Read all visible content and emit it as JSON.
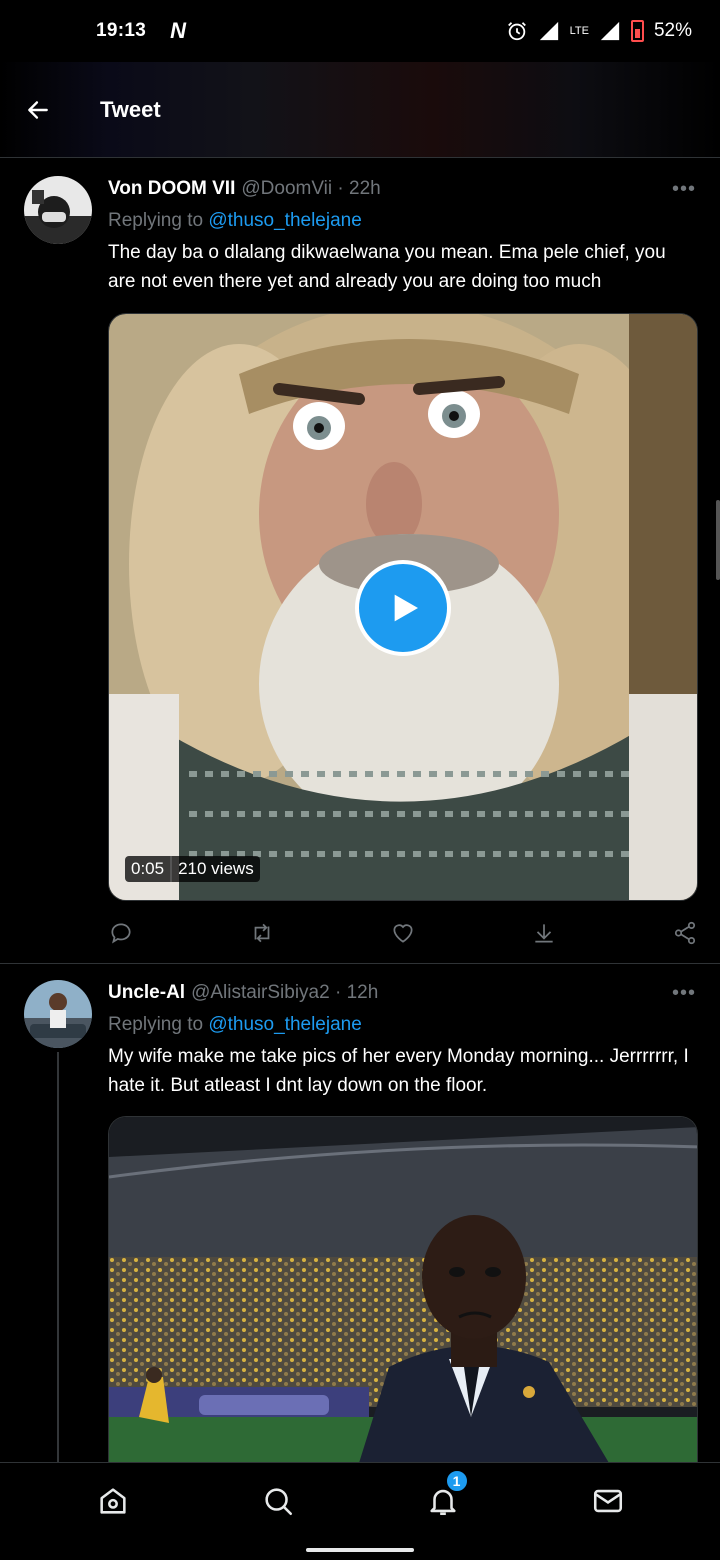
{
  "status": {
    "time": "19:13",
    "carrier_icon": "N",
    "network": "LTE",
    "battery": "52%"
  },
  "header": {
    "title": "Tweet"
  },
  "tweets": [
    {
      "name": "Von DOOM VII",
      "handle": "@DoomVii · 22h",
      "replying_prefix": "Replying to ",
      "replying_to": "@thuso_thelejane",
      "text": "The day ba o dlalang dikwaelwana you mean. Ema pele chief, you are not even there yet and already you are doing too much",
      "video": {
        "duration": "0:05",
        "views": "210 views"
      }
    },
    {
      "name": "Uncle-Al",
      "handle": "@AlistairSibiya2 · 12h",
      "replying_prefix": "Replying to ",
      "replying_to": "@thuso_thelejane",
      "text": "My wife make me take pics of her every Monday morning... Jerrrrrrr, I hate it. But atleast I dnt lay down on the floor."
    }
  ],
  "more_label": "•••",
  "nav": {
    "notifications_badge": "1"
  },
  "colors": {
    "accent": "#1d9bf0",
    "background": "#000000",
    "secondary_text": "#71767b"
  }
}
